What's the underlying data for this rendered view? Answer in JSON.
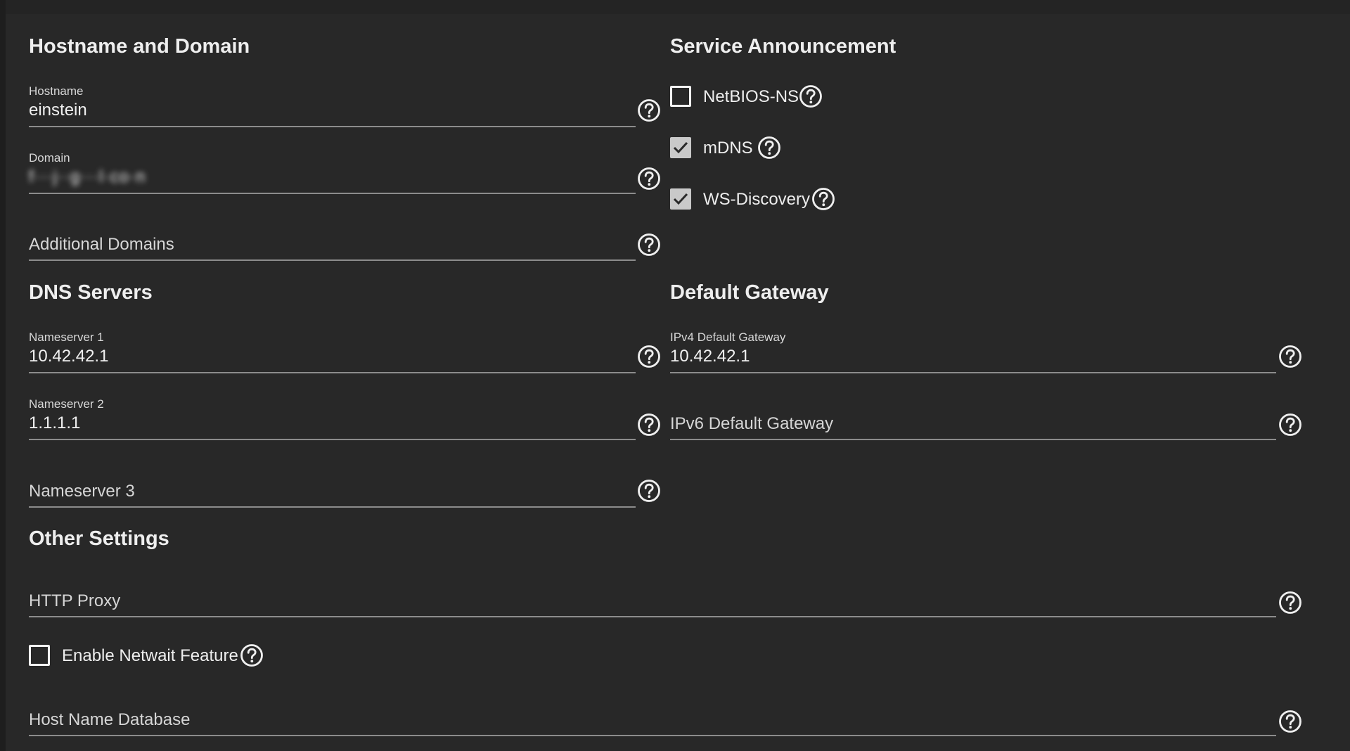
{
  "sections": {
    "hostname_domain": "Hostname and Domain",
    "service_announcement": "Service Announcement",
    "dns_servers": "DNS Servers",
    "default_gateway": "Default Gateway",
    "other_settings": "Other Settings"
  },
  "fields": {
    "hostname": {
      "label": "Hostname",
      "value": "einstein"
    },
    "domain": {
      "label": "Domain",
      "value": "f···j··g···l·co·n"
    },
    "additional_domains": {
      "placeholder": "Additional Domains"
    },
    "nameserver1": {
      "label": "Nameserver 1",
      "value": "10.42.42.1"
    },
    "nameserver2": {
      "label": "Nameserver 2",
      "value": "1.1.1.1"
    },
    "nameserver3": {
      "placeholder": "Nameserver 3"
    },
    "ipv4_gateway": {
      "label": "IPv4 Default Gateway",
      "value": "10.42.42.1"
    },
    "ipv6_gateway": {
      "placeholder": "IPv6 Default Gateway"
    },
    "http_proxy": {
      "placeholder": "HTTP Proxy"
    },
    "host_name_database": {
      "placeholder": "Host Name Database"
    }
  },
  "checkboxes": {
    "netbios_ns": {
      "label": "NetBIOS-NS",
      "checked": false
    },
    "mdns": {
      "label": "mDNS",
      "checked": true
    },
    "ws_discovery": {
      "label": "WS-Discovery",
      "checked": true
    },
    "netwait": {
      "label": "Enable Netwait Feature",
      "checked": false
    }
  },
  "icons": {
    "help": "help-circle-icon",
    "check": "check-icon"
  },
  "colors": {
    "background": "#282828",
    "text": "#eeeeee",
    "underline": "#8c8c8c",
    "checked_fill": "#c9c9c9"
  }
}
